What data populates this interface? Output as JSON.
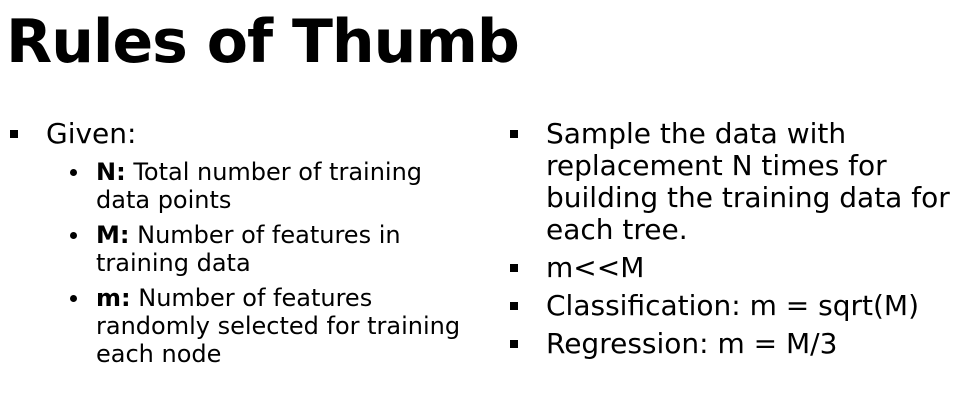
{
  "title": "Rules of Thumb",
  "left": {
    "given_label": "Given:",
    "items": [
      {
        "term": "N:",
        "text": " Total number of training data points"
      },
      {
        "term": "M:",
        "text": " Number of features in training data"
      },
      {
        "term": "m:",
        "text": " Number of features randomly selected for training each node"
      }
    ]
  },
  "right": {
    "items": [
      "Sample the data with replacement N times for building the training data for each tree.",
      "m<<M",
      "Classification: m = sqrt(M)",
      "Regression: m = M/3"
    ]
  }
}
